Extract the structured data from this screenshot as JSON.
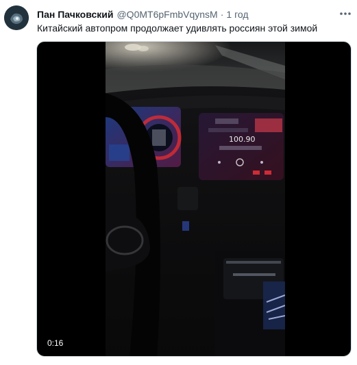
{
  "tweet": {
    "author_name": "Пан Пачковский",
    "author_handle": "@Q0MT6pFmbVqynsM",
    "separator": "·",
    "timestamp": "1 год",
    "text": "Китайский автопром продолжает удивлять россиян этой зимой",
    "more_icon": "more-horizontal-icon"
  },
  "video": {
    "duration": "0:16",
    "screen_reading": "100.90"
  },
  "colors": {
    "name": "#0f1419",
    "secondary": "#536471",
    "accent_red": "#e0303a"
  }
}
